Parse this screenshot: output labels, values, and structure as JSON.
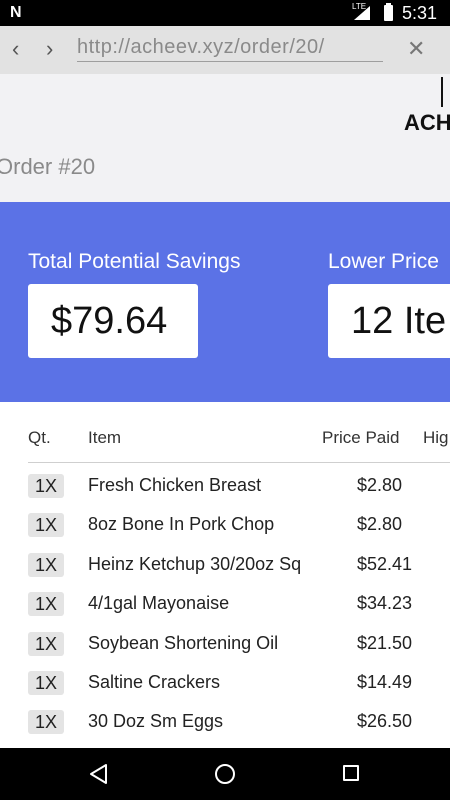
{
  "status_bar": {
    "notification_icon": "N",
    "network": "LTE",
    "time": "5:31"
  },
  "browser": {
    "url": "http://acheev.xyz/order/20/",
    "back_icon": "‹",
    "forward_icon": "›",
    "close_icon": "✕"
  },
  "header": {
    "logo_text": "ACH",
    "order_title": "Order #20"
  },
  "summary": {
    "savings_label": "Total Potential Savings",
    "savings_value": "$79.64",
    "lower_price_label": "Lower Price",
    "lower_price_value": "12 Ite"
  },
  "table": {
    "headers": [
      "Qt.",
      "Item",
      "Price Paid",
      "Hig"
    ],
    "rows": [
      {
        "qty": "1X",
        "item": "Fresh Chicken Breast",
        "price": "$2.80"
      },
      {
        "qty": "1X",
        "item": "8oz Bone In Pork Chop",
        "price": "$2.80"
      },
      {
        "qty": "1X",
        "item": "Heinz Ketchup 30/20oz Sq",
        "price": "$52.41"
      },
      {
        "qty": "1X",
        "item": "4/1gal Mayonaise",
        "price": "$34.23"
      },
      {
        "qty": "1X",
        "item": "Soybean Shortening Oil",
        "price": "$21.50"
      },
      {
        "qty": "1X",
        "item": "Saltine Crackers",
        "price": "$14.49"
      },
      {
        "qty": "1X",
        "item": "30 Doz Sm Eggs",
        "price": "$26.50"
      }
    ]
  },
  "colors": {
    "banner": "#5b72e6",
    "header_bg": "#f2f2f4",
    "badge_bg": "#e4e4e4"
  }
}
